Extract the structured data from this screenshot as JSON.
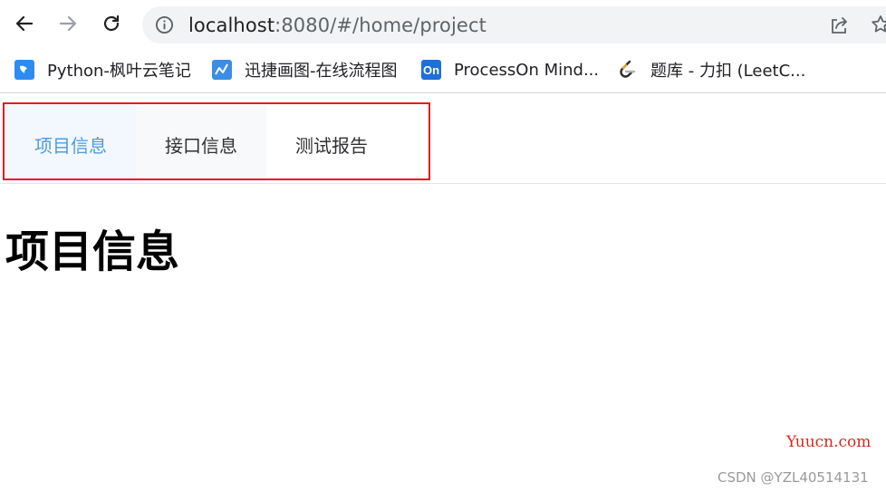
{
  "browser": {
    "url_host": "localhost",
    "url_path": ":8080/#/home/project",
    "icons": [
      "back-icon",
      "forward-icon",
      "reload-icon",
      "info-icon",
      "share-icon",
      "star-icon"
    ]
  },
  "bookmarks": [
    {
      "label": "Python-枫叶云笔记",
      "icon": "bookmark-note-icon",
      "color": "#2d8cf0"
    },
    {
      "label": "迅捷画图-在线流程图",
      "icon": "bookmark-chart-icon",
      "color": "#3a8ee6"
    },
    {
      "label": "ProcessOn Mind...",
      "icon_text": "On",
      "color": "#1e6fd9"
    },
    {
      "label": "题库 - 力扣 (LeetC...",
      "icon": "leetcode-icon",
      "color": "#f89f1b"
    }
  ],
  "menu": {
    "items": [
      {
        "label": "项目信息",
        "active": true
      },
      {
        "label": "接口信息",
        "active": false
      },
      {
        "label": "测试报告",
        "active": false
      }
    ],
    "active_color": "#4d9be0",
    "highlight_color": "#e8191a"
  },
  "page": {
    "heading": "项目信息"
  },
  "watermarks": {
    "site": "Yuucn.com",
    "author": "CSDN @YZL40514131"
  }
}
